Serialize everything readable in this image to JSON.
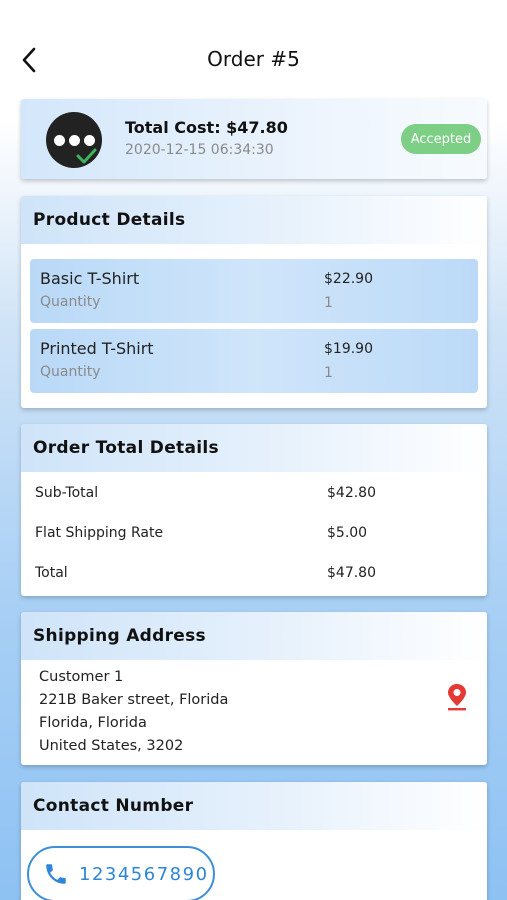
{
  "header": {
    "title": "Order #5"
  },
  "status": {
    "total_cost": "Total Cost: $47.80",
    "date": "2020-12-15 06:34:30",
    "badge": "Accepted"
  },
  "product_details": {
    "title": "Product Details",
    "items": [
      {
        "name": "Basic T-Shirt",
        "qty_label": "Quantity",
        "price": "$22.90",
        "qty": "1"
      },
      {
        "name": "Printed T-Shirt",
        "qty_label": "Quantity",
        "price": "$19.90",
        "qty": "1"
      }
    ]
  },
  "order_totals": {
    "title": "Order Total Details",
    "rows": [
      {
        "label": "Sub-Total",
        "value": "$42.80"
      },
      {
        "label": "Flat Shipping Rate",
        "value": "$5.00"
      },
      {
        "label": "Total",
        "value": "$47.80"
      }
    ]
  },
  "shipping": {
    "title": "Shipping Address",
    "lines": [
      "Customer 1",
      "221B Baker street, Florida",
      "Florida, Florida",
      "United States, 3202"
    ]
  },
  "contact": {
    "title": "Contact Number",
    "phone": "1234567890"
  },
  "colors": {
    "accent": "#2f86d6",
    "badge": "#7ccf85",
    "pin": "#e53935"
  }
}
